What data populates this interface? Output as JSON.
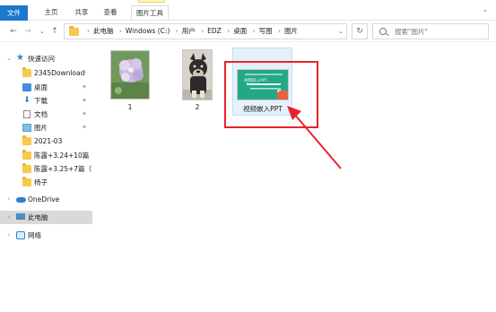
{
  "ribbon": {
    "tabs": [
      {
        "label": "文件"
      },
      {
        "label": "主页"
      },
      {
        "label": "共享"
      },
      {
        "label": "查看"
      },
      {
        "label": "图片工具"
      }
    ],
    "expand_glyph": "⌄"
  },
  "nav": {
    "back_glyph": "←",
    "forward_glyph": "→",
    "recent_glyph": "⌄",
    "up_glyph": "↑"
  },
  "address": {
    "crumbs": [
      "此电脑",
      "Windows (C:)",
      "用户",
      "EDZ",
      "桌面",
      "写图",
      "图片"
    ],
    "separator": "›",
    "dropdown_glyph": "⌄",
    "refresh_glyph": "↻"
  },
  "search": {
    "placeholder": "搜索\"图片\""
  },
  "sidebar": {
    "items": [
      {
        "label": "快速访问",
        "icon": "star-icon",
        "expanded": true
      },
      {
        "label": "2345Download",
        "icon": "folder-icon",
        "pinned": true
      },
      {
        "label": "桌面",
        "icon": "desktop-icon",
        "pinned": true
      },
      {
        "label": "下载",
        "icon": "download-icon",
        "pinned": true
      },
      {
        "label": "文档",
        "icon": "document-icon",
        "pinned": true
      },
      {
        "label": "图片",
        "icon": "pictures-icon",
        "pinned": true
      },
      {
        "label": "2021-03",
        "icon": "folder-icon"
      },
      {
        "label": "陈露+3.24+10篇（",
        "icon": "folder-icon"
      },
      {
        "label": "陈露+3.25+7篇（1",
        "icon": "folder-icon"
      },
      {
        "label": "椅子",
        "icon": "folder-icon"
      },
      {
        "label": "OneDrive",
        "icon": "cloud-icon"
      },
      {
        "label": "此电脑",
        "icon": "computer-icon",
        "selected": true
      },
      {
        "label": "网络",
        "icon": "network-icon"
      }
    ],
    "pin_glyph": "📌",
    "chevron_right": "›",
    "chevron_down": "⌄"
  },
  "files": [
    {
      "name": "1",
      "type": "image"
    },
    {
      "name": "2",
      "type": "image"
    },
    {
      "name": "视频嵌入PPT",
      "type": "powerpoint",
      "selected": true,
      "thumb_text": "视频嵌入PPT"
    }
  ],
  "colors": {
    "accent": "#1979ca",
    "annotation": "#e8242a",
    "selection": "#e5f1fb",
    "folder": "#f8c94c"
  }
}
